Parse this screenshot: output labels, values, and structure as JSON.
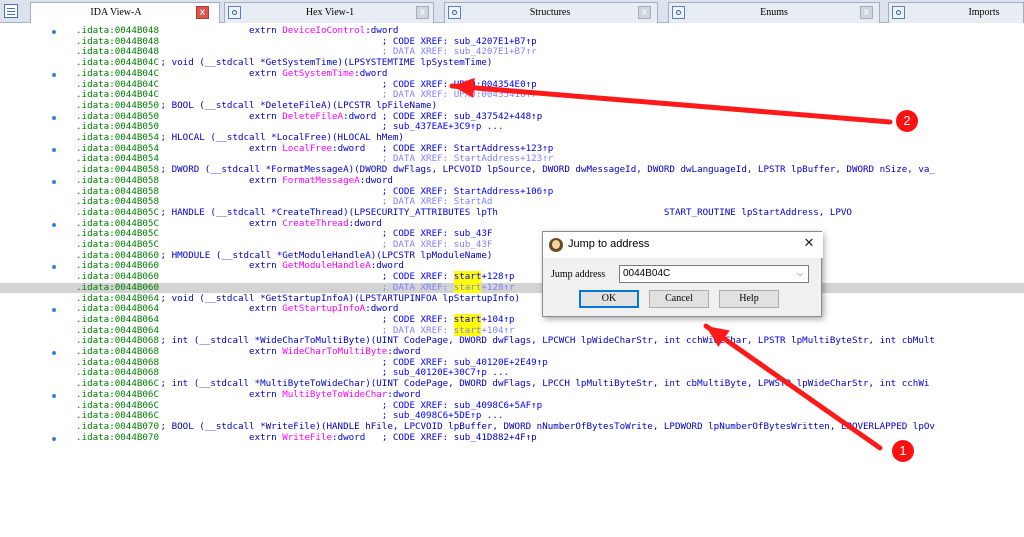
{
  "tabs": [
    {
      "label": "IDA View-A",
      "active": true,
      "icon": "ida-view-icon"
    },
    {
      "label": "Hex View-1",
      "active": false,
      "icon": "hex-view-icon"
    },
    {
      "label": "Structures",
      "active": false,
      "icon": "structures-icon"
    },
    {
      "label": "Enums",
      "active": false,
      "icon": "enums-icon"
    },
    {
      "label": "Imports",
      "active": false,
      "icon": "imports-icon"
    }
  ],
  "tab_close_glyph": "x",
  "lines": [
    {
      "addr": ".idata:0044B048",
      "dot": true,
      "parts": [
        {
          "t": "                 extrn ",
          "c": "c-blue"
        },
        {
          "t": "DeviceIoControl",
          "c": "c-func"
        },
        {
          "t": ":dword",
          "c": "c-blue"
        }
      ]
    },
    {
      "addr": ".idata:0044B048",
      "dot": false,
      "parts": [
        {
          "t": "                                         ; CODE XREF: sub_4207E1+B7↑p",
          "c": "c-cmt"
        }
      ]
    },
    {
      "addr": ".idata:0044B048",
      "dot": false,
      "parts": [
        {
          "t": "                                         ; DATA XREF: sub_4207E1+B7↑r",
          "c": "c-cmtdim"
        }
      ]
    },
    {
      "addr": ".idata:0044B04C",
      "dot": false,
      "parts": [
        {
          "t": " ; void (__stdcall *GetSystemTime)(LPSYSTEMTIME lpSystemTime)",
          "c": "c-blue"
        }
      ]
    },
    {
      "addr": ".idata:0044B04C",
      "dot": true,
      "parts": [
        {
          "t": "                 extrn ",
          "c": "c-blue"
        },
        {
          "t": "GetSystemTime",
          "c": "c-func"
        },
        {
          "t": ":dword",
          "c": "c-blue"
        }
      ]
    },
    {
      "addr": ".idata:0044B04C",
      "dot": false,
      "parts": [
        {
          "t": "                                         ; CODE XREF: UPX0:004354E0↑p",
          "c": "c-cmt"
        }
      ]
    },
    {
      "addr": ".idata:0044B04C",
      "dot": false,
      "parts": [
        {
          "t": "                                         ; DATA XREF: UPX0:00435418↑r",
          "c": "c-cmtdim"
        }
      ]
    },
    {
      "addr": ".idata:0044B050",
      "dot": false,
      "parts": [
        {
          "t": " ; BOOL (__stdcall *DeleteFileA)(LPCSTR lpFileName)",
          "c": "c-blue"
        }
      ]
    },
    {
      "addr": ".idata:0044B050",
      "dot": true,
      "parts": [
        {
          "t": "                 extrn ",
          "c": "c-blue"
        },
        {
          "t": "DeleteFileA",
          "c": "c-func"
        },
        {
          "t": ":dword ; CODE XREF: sub_437542+448↑p",
          "c": "c-blue"
        }
      ]
    },
    {
      "addr": ".idata:0044B050",
      "dot": false,
      "parts": [
        {
          "t": "                                         ; sub_437EAE+3C9↑p ...",
          "c": "c-cmt"
        }
      ]
    },
    {
      "addr": ".idata:0044B054",
      "dot": false,
      "parts": [
        {
          "t": " ; HLOCAL (__stdcall *LocalFree)(HLOCAL hMem)",
          "c": "c-blue"
        }
      ]
    },
    {
      "addr": ".idata:0044B054",
      "dot": true,
      "parts": [
        {
          "t": "                 extrn ",
          "c": "c-blue"
        },
        {
          "t": "LocalFree",
          "c": "c-func"
        },
        {
          "t": ":dword   ; CODE XREF: StartAddress+123↑p",
          "c": "c-blue"
        }
      ]
    },
    {
      "addr": ".idata:0044B054",
      "dot": false,
      "parts": [
        {
          "t": "                                         ; DATA XREF: StartAddress+123↑r",
          "c": "c-cmtdim"
        }
      ]
    },
    {
      "addr": ".idata:0044B058",
      "dot": false,
      "parts": [
        {
          "t": " ; DWORD (__stdcall *FormatMessageA)(DWORD dwFlags, LPCVOID lpSource, DWORD dwMessageId, DWORD dwLanguageId, LPSTR lpBuffer, DWORD nSize, va_",
          "c": "c-blue"
        }
      ]
    },
    {
      "addr": ".idata:0044B058",
      "dot": true,
      "parts": [
        {
          "t": "                 extrn ",
          "c": "c-blue"
        },
        {
          "t": "FormatMessageA",
          "c": "c-func"
        },
        {
          "t": ":dword",
          "c": "c-blue"
        }
      ]
    },
    {
      "addr": ".idata:0044B058",
      "dot": false,
      "parts": [
        {
          "t": "                                         ; CODE XREF: StartAddress+106↑p",
          "c": "c-cmt"
        }
      ]
    },
    {
      "addr": ".idata:0044B058",
      "dot": false,
      "parts": [
        {
          "t": "                                         ; DATA XREF: StartAd",
          "c": "c-cmtdim"
        }
      ]
    },
    {
      "addr": ".idata:0044B05C",
      "dot": false,
      "parts": [
        {
          "t": " ; HANDLE (__stdcall *CreateThread)(LPSECURITY_ATTRIBUTES lpTh",
          "c": "c-blue"
        },
        {
          "t": "                              START_ROUTINE lpStartAddress, LPVO",
          "c": "c-blue"
        }
      ]
    },
    {
      "addr": ".idata:0044B05C",
      "dot": true,
      "parts": [
        {
          "t": "                 extrn ",
          "c": "c-blue"
        },
        {
          "t": "CreateThread",
          "c": "c-func"
        },
        {
          "t": ":dword",
          "c": "c-blue"
        }
      ]
    },
    {
      "addr": ".idata:0044B05C",
      "dot": false,
      "parts": [
        {
          "t": "                                         ; CODE XREF: sub_43F",
          "c": "c-cmt"
        }
      ]
    },
    {
      "addr": ".idata:0044B05C",
      "dot": false,
      "parts": [
        {
          "t": "                                         ; DATA XREF: sub_43F",
          "c": "c-cmtdim"
        }
      ]
    },
    {
      "addr": ".idata:0044B060",
      "dot": false,
      "parts": [
        {
          "t": " ; HMODULE (__stdcall *GetModuleHandleA)(LPCSTR lpModuleName)",
          "c": "c-blue"
        }
      ]
    },
    {
      "addr": ".idata:0044B060",
      "dot": true,
      "parts": [
        {
          "t": "                 extrn ",
          "c": "c-blue"
        },
        {
          "t": "GetModuleHandleA",
          "c": "c-func"
        },
        {
          "t": ":dword",
          "c": "c-blue"
        }
      ]
    },
    {
      "addr": ".idata:0044B060",
      "dot": false,
      "parts": [
        {
          "t": "                                         ; CODE XREF: ",
          "c": "c-cmt"
        },
        {
          "t": "start",
          "c": "c-cmt c-yel"
        },
        {
          "t": "+128↑p",
          "c": "c-cmt"
        }
      ]
    },
    {
      "addr": ".idata:0044B060",
      "dot": false,
      "hl": true,
      "parts": [
        {
          "t": "                                         ; DATA XREF: ",
          "c": "c-cmtdim"
        },
        {
          "t": "start",
          "c": "c-cmtdim c-yel"
        },
        {
          "t": "+128↑r",
          "c": "c-cmtdim"
        }
      ]
    },
    {
      "addr": ".idata:0044B064",
      "dot": false,
      "parts": [
        {
          "t": " ; void (__stdcall *GetStartupInfoA)(LPSTARTUPINFOA lpStartupInfo)",
          "c": "c-blue"
        }
      ]
    },
    {
      "addr": ".idata:0044B064",
      "dot": true,
      "parts": [
        {
          "t": "                 extrn ",
          "c": "c-blue"
        },
        {
          "t": "GetStartupInfoA",
          "c": "c-func"
        },
        {
          "t": ":dword",
          "c": "c-blue"
        }
      ]
    },
    {
      "addr": ".idata:0044B064",
      "dot": false,
      "parts": [
        {
          "t": "                                         ; CODE XREF: ",
          "c": "c-cmt"
        },
        {
          "t": "start",
          "c": "c-cmt c-yel"
        },
        {
          "t": "+104↑p",
          "c": "c-cmt"
        }
      ]
    },
    {
      "addr": ".idata:0044B064",
      "dot": false,
      "parts": [
        {
          "t": "                                         ; DATA XREF: ",
          "c": "c-cmtdim"
        },
        {
          "t": "start",
          "c": "c-cmtdim c-yel"
        },
        {
          "t": "+104↑r",
          "c": "c-cmtdim"
        }
      ]
    },
    {
      "addr": ".idata:0044B068",
      "dot": false,
      "parts": [
        {
          "t": " ; int (__stdcall *WideCharToMultiByte)(UINT CodePage, DWORD dwFlags, LPCWCH lpWideCharStr, int cchWideChar, LPSTR lpMultiByteStr, int cbMult",
          "c": "c-blue"
        }
      ]
    },
    {
      "addr": ".idata:0044B068",
      "dot": true,
      "parts": [
        {
          "t": "                 extrn ",
          "c": "c-blue"
        },
        {
          "t": "WideCharToMultiByte",
          "c": "c-func"
        },
        {
          "t": ":dword",
          "c": "c-blue"
        }
      ]
    },
    {
      "addr": ".idata:0044B068",
      "dot": false,
      "parts": [
        {
          "t": "                                         ; CODE XREF: sub_40120E+2E49↑p",
          "c": "c-cmt"
        }
      ]
    },
    {
      "addr": ".idata:0044B068",
      "dot": false,
      "parts": [
        {
          "t": "                                         ; sub_40120E+30C7↑p ...",
          "c": "c-cmt"
        }
      ]
    },
    {
      "addr": ".idata:0044B06C",
      "dot": false,
      "parts": [
        {
          "t": " ; int (__stdcall *MultiByteToWideChar)(UINT CodePage, DWORD dwFlags, LPCCH lpMultiByteStr, int cbMultiByte, LPWSTR lpWideCharStr, int cchWi",
          "c": "c-blue"
        }
      ]
    },
    {
      "addr": ".idata:0044B06C",
      "dot": true,
      "parts": [
        {
          "t": "                 extrn ",
          "c": "c-blue"
        },
        {
          "t": "MultiByteToWideChar",
          "c": "c-func"
        },
        {
          "t": ":dword",
          "c": "c-blue"
        }
      ]
    },
    {
      "addr": ".idata:0044B06C",
      "dot": false,
      "parts": [
        {
          "t": "                                         ; CODE XREF: sub_4098C6+5AF↑p",
          "c": "c-cmt"
        }
      ]
    },
    {
      "addr": ".idata:0044B06C",
      "dot": false,
      "parts": [
        {
          "t": "                                         ; sub_4098C6+5DE↑p ...",
          "c": "c-cmt"
        }
      ]
    },
    {
      "addr": ".idata:0044B070",
      "dot": false,
      "parts": [
        {
          "t": " ; BOOL (__stdcall *WriteFile)(HANDLE hFile, LPCVOID lpBuffer, DWORD nNumberOfBytesToWrite, LPDWORD lpNumberOfBytesWritten, LPOVERLAPPED lpOv",
          "c": "c-blue"
        }
      ]
    },
    {
      "addr": ".idata:0044B070",
      "dot": true,
      "parts": [
        {
          "t": "                 extrn ",
          "c": "c-blue"
        },
        {
          "t": "WriteFile",
          "c": "c-func"
        },
        {
          "t": ":dword   ; CODE XREF: sub_41D882+4F↑p",
          "c": "c-blue"
        }
      ]
    }
  ],
  "dialog": {
    "title": "Jump to address",
    "close_glyph": "✕",
    "label": "Jump address",
    "value": "0044B04C",
    "dropdown_glyph": "⌵",
    "ok": "OK",
    "cancel": "Cancel",
    "help": "Help",
    "icon": "ida-app-icon"
  },
  "annotations": {
    "badge1": "1",
    "badge2": "2",
    "arrow_color": "#ff1a1a"
  }
}
